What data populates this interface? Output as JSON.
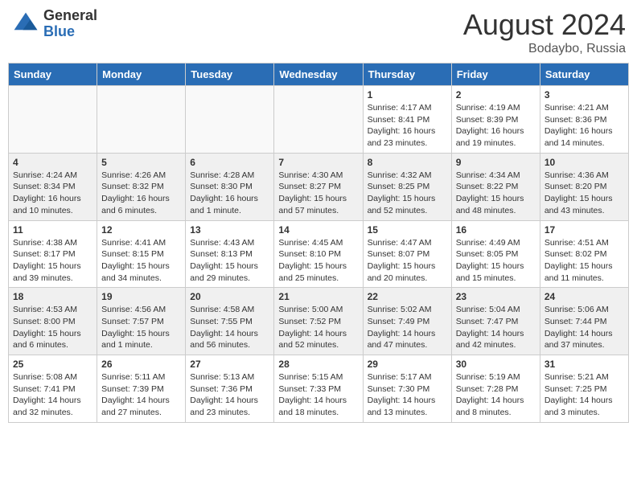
{
  "header": {
    "logo_general": "General",
    "logo_blue": "Blue",
    "month": "August 2024",
    "location": "Bodaybo, Russia"
  },
  "days_of_week": [
    "Sunday",
    "Monday",
    "Tuesday",
    "Wednesday",
    "Thursday",
    "Friday",
    "Saturday"
  ],
  "weeks": [
    {
      "style": "white",
      "days": [
        {
          "num": "",
          "info": "",
          "empty": true
        },
        {
          "num": "",
          "info": "",
          "empty": true
        },
        {
          "num": "",
          "info": "",
          "empty": true
        },
        {
          "num": "",
          "info": "",
          "empty": true
        },
        {
          "num": "1",
          "info": "Sunrise: 4:17 AM\nSunset: 8:41 PM\nDaylight: 16 hours\nand 23 minutes.",
          "empty": false
        },
        {
          "num": "2",
          "info": "Sunrise: 4:19 AM\nSunset: 8:39 PM\nDaylight: 16 hours\nand 19 minutes.",
          "empty": false
        },
        {
          "num": "3",
          "info": "Sunrise: 4:21 AM\nSunset: 8:36 PM\nDaylight: 16 hours\nand 14 minutes.",
          "empty": false
        }
      ]
    },
    {
      "style": "gray",
      "days": [
        {
          "num": "4",
          "info": "Sunrise: 4:24 AM\nSunset: 8:34 PM\nDaylight: 16 hours\nand 10 minutes.",
          "empty": false
        },
        {
          "num": "5",
          "info": "Sunrise: 4:26 AM\nSunset: 8:32 PM\nDaylight: 16 hours\nand 6 minutes.",
          "empty": false
        },
        {
          "num": "6",
          "info": "Sunrise: 4:28 AM\nSunset: 8:30 PM\nDaylight: 16 hours\nand 1 minute.",
          "empty": false
        },
        {
          "num": "7",
          "info": "Sunrise: 4:30 AM\nSunset: 8:27 PM\nDaylight: 15 hours\nand 57 minutes.",
          "empty": false
        },
        {
          "num": "8",
          "info": "Sunrise: 4:32 AM\nSunset: 8:25 PM\nDaylight: 15 hours\nand 52 minutes.",
          "empty": false
        },
        {
          "num": "9",
          "info": "Sunrise: 4:34 AM\nSunset: 8:22 PM\nDaylight: 15 hours\nand 48 minutes.",
          "empty": false
        },
        {
          "num": "10",
          "info": "Sunrise: 4:36 AM\nSunset: 8:20 PM\nDaylight: 15 hours\nand 43 minutes.",
          "empty": false
        }
      ]
    },
    {
      "style": "white",
      "days": [
        {
          "num": "11",
          "info": "Sunrise: 4:38 AM\nSunset: 8:17 PM\nDaylight: 15 hours\nand 39 minutes.",
          "empty": false
        },
        {
          "num": "12",
          "info": "Sunrise: 4:41 AM\nSunset: 8:15 PM\nDaylight: 15 hours\nand 34 minutes.",
          "empty": false
        },
        {
          "num": "13",
          "info": "Sunrise: 4:43 AM\nSunset: 8:13 PM\nDaylight: 15 hours\nand 29 minutes.",
          "empty": false
        },
        {
          "num": "14",
          "info": "Sunrise: 4:45 AM\nSunset: 8:10 PM\nDaylight: 15 hours\nand 25 minutes.",
          "empty": false
        },
        {
          "num": "15",
          "info": "Sunrise: 4:47 AM\nSunset: 8:07 PM\nDaylight: 15 hours\nand 20 minutes.",
          "empty": false
        },
        {
          "num": "16",
          "info": "Sunrise: 4:49 AM\nSunset: 8:05 PM\nDaylight: 15 hours\nand 15 minutes.",
          "empty": false
        },
        {
          "num": "17",
          "info": "Sunrise: 4:51 AM\nSunset: 8:02 PM\nDaylight: 15 hours\nand 11 minutes.",
          "empty": false
        }
      ]
    },
    {
      "style": "gray",
      "days": [
        {
          "num": "18",
          "info": "Sunrise: 4:53 AM\nSunset: 8:00 PM\nDaylight: 15 hours\nand 6 minutes.",
          "empty": false
        },
        {
          "num": "19",
          "info": "Sunrise: 4:56 AM\nSunset: 7:57 PM\nDaylight: 15 hours\nand 1 minute.",
          "empty": false
        },
        {
          "num": "20",
          "info": "Sunrise: 4:58 AM\nSunset: 7:55 PM\nDaylight: 14 hours\nand 56 minutes.",
          "empty": false
        },
        {
          "num": "21",
          "info": "Sunrise: 5:00 AM\nSunset: 7:52 PM\nDaylight: 14 hours\nand 52 minutes.",
          "empty": false
        },
        {
          "num": "22",
          "info": "Sunrise: 5:02 AM\nSunset: 7:49 PM\nDaylight: 14 hours\nand 47 minutes.",
          "empty": false
        },
        {
          "num": "23",
          "info": "Sunrise: 5:04 AM\nSunset: 7:47 PM\nDaylight: 14 hours\nand 42 minutes.",
          "empty": false
        },
        {
          "num": "24",
          "info": "Sunrise: 5:06 AM\nSunset: 7:44 PM\nDaylight: 14 hours\nand 37 minutes.",
          "empty": false
        }
      ]
    },
    {
      "style": "white",
      "days": [
        {
          "num": "25",
          "info": "Sunrise: 5:08 AM\nSunset: 7:41 PM\nDaylight: 14 hours\nand 32 minutes.",
          "empty": false
        },
        {
          "num": "26",
          "info": "Sunrise: 5:11 AM\nSunset: 7:39 PM\nDaylight: 14 hours\nand 27 minutes.",
          "empty": false
        },
        {
          "num": "27",
          "info": "Sunrise: 5:13 AM\nSunset: 7:36 PM\nDaylight: 14 hours\nand 23 minutes.",
          "empty": false
        },
        {
          "num": "28",
          "info": "Sunrise: 5:15 AM\nSunset: 7:33 PM\nDaylight: 14 hours\nand 18 minutes.",
          "empty": false
        },
        {
          "num": "29",
          "info": "Sunrise: 5:17 AM\nSunset: 7:30 PM\nDaylight: 14 hours\nand 13 minutes.",
          "empty": false
        },
        {
          "num": "30",
          "info": "Sunrise: 5:19 AM\nSunset: 7:28 PM\nDaylight: 14 hours\nand 8 minutes.",
          "empty": false
        },
        {
          "num": "31",
          "info": "Sunrise: 5:21 AM\nSunset: 7:25 PM\nDaylight: 14 hours\nand 3 minutes.",
          "empty": false
        }
      ]
    }
  ]
}
